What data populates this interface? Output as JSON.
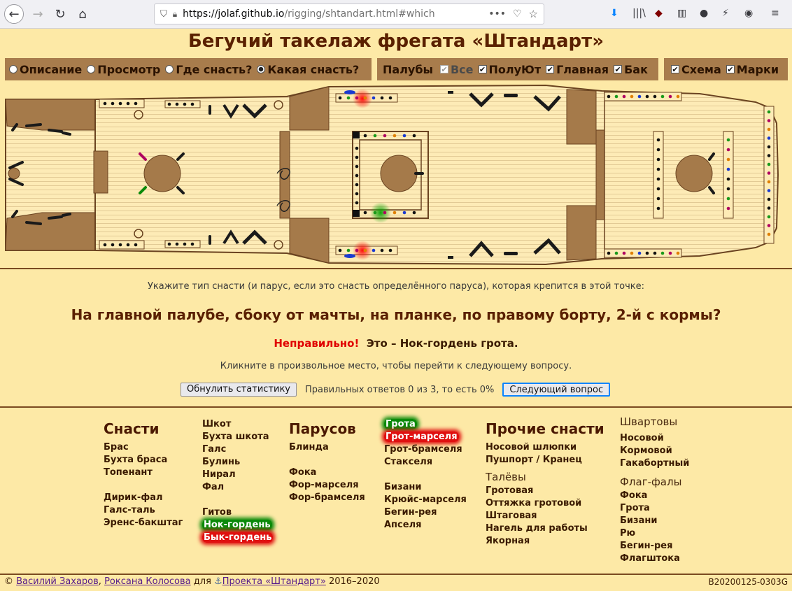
{
  "browser": {
    "url_host": "https://jolaf.github.io",
    "url_path": "/rigging/shtandart.html#which"
  },
  "page_title": "Бегучий такелаж фрегата «Штандарт»",
  "modes": [
    {
      "label": "Описание",
      "selected": false
    },
    {
      "label": "Просмотр",
      "selected": false
    },
    {
      "label": "Где снасть?",
      "selected": false
    },
    {
      "label": "Какая снасть?",
      "selected": true
    }
  ],
  "decks": {
    "label": "Палубы",
    "items": [
      {
        "label": "Все",
        "checked": true,
        "disabled": true
      },
      {
        "label": "ПолуЮт",
        "checked": true
      },
      {
        "label": "Главная",
        "checked": true
      },
      {
        "label": "Бак",
        "checked": true
      }
    ]
  },
  "view": {
    "items": [
      {
        "label": "Схема",
        "checked": true
      },
      {
        "label": "Марки",
        "checked": true
      }
    ]
  },
  "question": {
    "hint": "Укажите тип снасти (и парус, если это снасть определённого паруса), которая крепится в этой точке:",
    "text": "На главной палубе, сбоку от мачты, на планке, по правому борту, 2-й с кормы?",
    "verdict": "Неправильно!",
    "answer": "Это – Нок-гордень грота.",
    "click_hint": "Кликните в произвольное место, чтобы перейти к следующему вопросу.",
    "reset_button": "Обнулить статистику",
    "stats": "Правильных ответов 0 из 3, то есть 0%",
    "next_button": "Следующий вопрос"
  },
  "reference": {
    "gear_head": "Снасти",
    "gear_col1": [
      "Брас",
      "Бухта браса",
      "Топенант",
      "",
      "Дирик-фал",
      "Галс-таль",
      "Эренс-бакштаг"
    ],
    "gear_col2": [
      "Шкот",
      "Бухта шкота",
      "Галс",
      "Булинь",
      "Нирал",
      "Фал",
      "",
      "Гитов",
      "Нок-гордень",
      "Бык-гордень"
    ],
    "sails_head": "Парусов",
    "sails_col1": [
      "Блинда",
      "",
      "Фока",
      "Фор-марселя",
      "Фор-брамселя"
    ],
    "sails_col2": [
      "Грота",
      "Грот-марселя",
      "Грот-брамселя",
      "Стакселя",
      "",
      "Бизани",
      "Крюйс-марселя",
      "Бегин-рея",
      "Апселя"
    ],
    "other_head": "Прочие снасти",
    "other_items": [
      "Носовой шлюпки",
      "Пушпорт / Кранец"
    ],
    "tali_head": "Талёвы",
    "tali_items": [
      "Гротовая",
      "Оттяжка гротовой",
      "Штаговая",
      "Нагель для работы",
      "Якорная"
    ],
    "moor_head": "Швартовы",
    "moor_items": [
      "Носовой",
      "Кормовой",
      "Гакабортный"
    ],
    "flag_head": "Флаг-фалы",
    "flag_items": [
      "Фока",
      "Грота",
      "Бизани",
      "Рю",
      "Бегин-рея",
      "Флагштока"
    ]
  },
  "footer": {
    "copy": "©",
    "author1": "Василий Захаров",
    "sep": ",",
    "author2": "Роксана Колосова",
    "for": "для",
    "project": "Проекта «Штандарт»",
    "years": "2016–2020",
    "build": "B20200125-0303G"
  },
  "colors": {
    "background": "#fde9a6",
    "toolbar": "#a87c4c",
    "wood": "#a57a4a",
    "deck": "#fdebb6",
    "highlight_green": "#0a8a0a",
    "highlight_red": "#e01010",
    "wrong": "#e00000"
  }
}
